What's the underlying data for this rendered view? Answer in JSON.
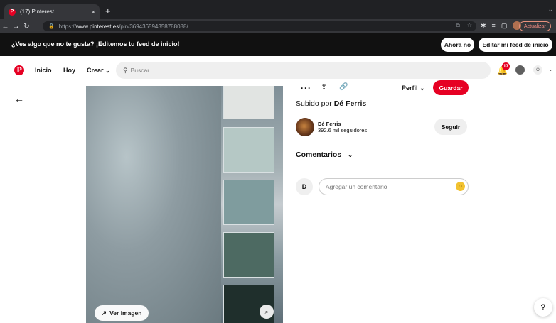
{
  "browser": {
    "tab_title": "(17) Pinterest",
    "tab_close": "×",
    "new_tab": "+",
    "tab_favicon": "P",
    "url_prefix": "https://",
    "url_host": "www.pinterest.es",
    "url_path": "/pin/369436594358788088/",
    "update_label": "Actualizar",
    "icons": [
      "back-arrow-icon",
      "forward-arrow-icon",
      "reload-icon",
      "lock-icon",
      "share-icon",
      "star-icon",
      "extensions-icon",
      "reading-list-icon",
      "split-view-icon",
      "profile-icon"
    ]
  },
  "banner": {
    "text": "¿Ves algo que no te gusta? ¡Editemos tu feed de inicio!",
    "now_label": "Ahora no",
    "edit_label": "Editar mi feed de inicio"
  },
  "header": {
    "logo": "P",
    "nav": {
      "home": "Inicio",
      "today": "Hoy",
      "create": "Crear"
    },
    "search_placeholder": "Buscar",
    "notifications_count": "17",
    "user_initial": "O"
  },
  "pin": {
    "image_button": "Ver imagen",
    "swatch_colors": [
      "#e1e4e2",
      "#b5c8c5",
      "#7f9c9e",
      "#4d6a62",
      "#1f2f2c"
    ],
    "board_select": "Perfil",
    "save_label": "Guardar",
    "uploaded_prefix": "Subido por",
    "uploaded_by": "Dé Ferris",
    "author": {
      "name": "Dé Ferris",
      "followers": "392.6 mil seguidores",
      "follow_label": "Seguir"
    },
    "comments_title": "Comentarios",
    "comment_initial": "D",
    "comment_placeholder": "Agregar un comentario",
    "help_label": "?"
  },
  "colors": {
    "brand_red": "#e60023",
    "banner_bg": "#111111",
    "chrome_dark": "#202124"
  }
}
